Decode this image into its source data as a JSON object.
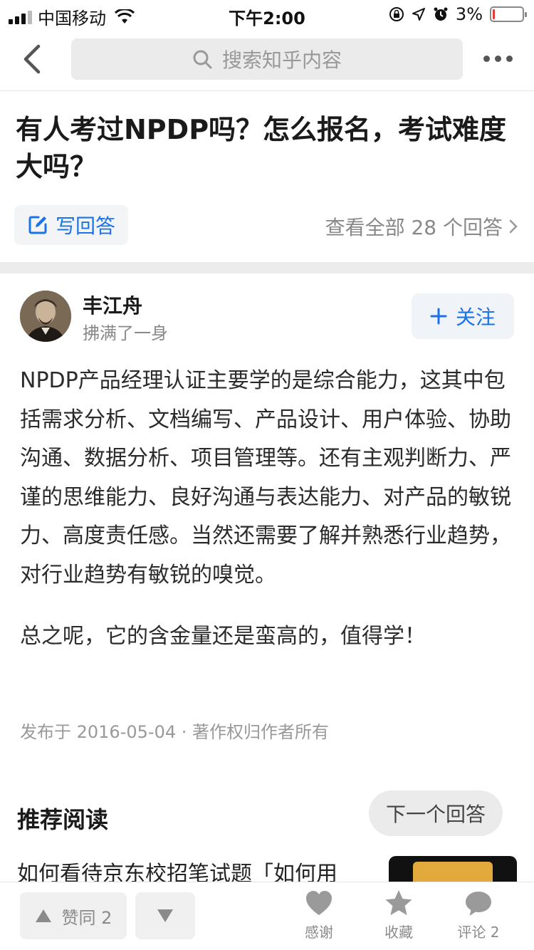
{
  "status_bar": {
    "carrier": "中国移动",
    "time": "下午2:00",
    "battery": "3%"
  },
  "nav": {
    "search_placeholder": "搜索知乎内容"
  },
  "question": {
    "title": "有人考过NPDP吗？怎么报名，考试难度大吗？",
    "write_answer_label": "写回答",
    "view_all_label": "查看全部 28 个回答",
    "answer_count": 28
  },
  "answer": {
    "author_name": "丰江舟",
    "author_bio": "拂满了一身",
    "follow_label": "关注",
    "paragraphs": [
      "NPDP产品经理认证主要学的是综合能力，这其中包括需求分析、文档编写、产品设计、用户体验、协助沟通、数据分析、项目管理等。还有主观判断力、严谨的思维能力、良好沟通与表达能力、对产品的敏锐力、高度责任感。当然还需要了解并熟悉行业趋势，对行业趋势有敏锐的嗅觉。",
      "总之呢，它的含金量还是蛮高的，值得学！"
    ],
    "publish_meta": "发布于 2016-05-04 · 著作权归作者所有"
  },
  "recommend": {
    "title": "推荐阅读",
    "next_answer_label": "下一个回答",
    "items": [
      {
        "title": "如何看待京东校招笔试题「如何用"
      }
    ]
  },
  "bottom_bar": {
    "vote_up_label": "赞同 2",
    "thanks_label": "感谢",
    "collect_label": "收藏",
    "comment_label": "评论 2"
  },
  "colors": {
    "accent": "#1a73e8",
    "muted": "#8a8a8a",
    "battery_low": "#e53935"
  }
}
